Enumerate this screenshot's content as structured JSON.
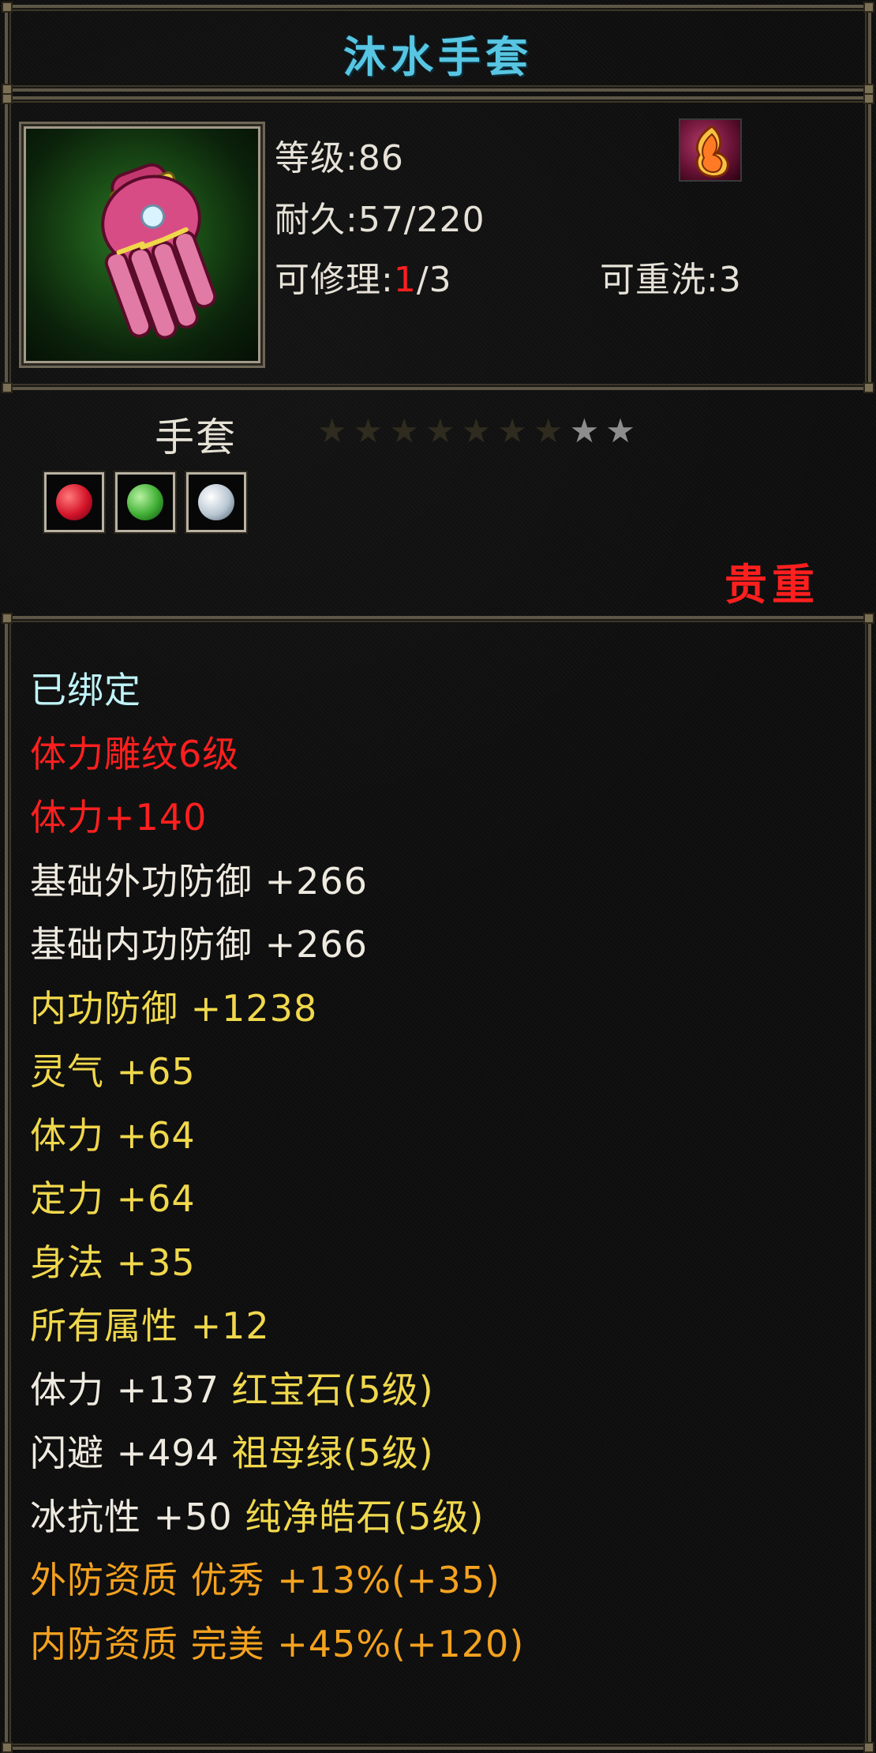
{
  "item": {
    "title": "沐水手套",
    "level_text": "等级:86",
    "durability_text": "耐久:57/220",
    "repair_prefix": "可修理:",
    "repair_current": "1",
    "repair_suffix": "/3",
    "rewash_text": "可重洗:3",
    "type_label": "手套",
    "rarity_label": "贵重",
    "stars": {
      "total": 9,
      "dim": 7,
      "lit": 2
    },
    "gems": [
      {
        "name": "红宝石",
        "icon": "ruby-gem-icon"
      },
      {
        "name": "祖母绿",
        "icon": "emerald-gem-icon"
      },
      {
        "name": "纯净皓石",
        "icon": "diamond-gem-icon"
      }
    ]
  },
  "attributes": [
    {
      "text": "已绑定",
      "color": "#bff3f7"
    },
    {
      "text": "体力雕纹6级",
      "color": "#ff1f1f"
    },
    {
      "text": "体力+140",
      "color": "#ff1f1f"
    },
    {
      "text": "基础外功防御 +266",
      "color": "#efeae0"
    },
    {
      "text": "基础内功防御 +266",
      "color": "#efeae0"
    },
    {
      "text": "内功防御 +1238",
      "color": "#f0d84c"
    },
    {
      "text": "灵气 +65",
      "color": "#f0d84c"
    },
    {
      "text": "体力 +64",
      "color": "#f0d84c"
    },
    {
      "text": "定力 +64",
      "color": "#f0d84c"
    },
    {
      "text": "身法 +35",
      "color": "#f0d84c"
    },
    {
      "text": "所有属性 +12",
      "color": "#f0d84c"
    },
    {
      "text_prefix": "体力 +137 ",
      "text_gem": "红宝石(5级)",
      "prefix_color": "#efeae0",
      "gem_color": "#f0d84c"
    },
    {
      "text_prefix": "闪避 +494 ",
      "text_gem": "祖母绿(5级)",
      "prefix_color": "#efeae0",
      "gem_color": "#f0d84c"
    },
    {
      "text_prefix": "冰抗性 +50 ",
      "text_gem": "纯净皓石(5级)",
      "prefix_color": "#efeae0",
      "gem_color": "#f0d84c"
    },
    {
      "text": "外防资质  优秀 +13%(+35)",
      "color": "#f4a21f"
    },
    {
      "text": "内防资质  完美 +45%(+120)",
      "color": "#f4a21f"
    }
  ]
}
